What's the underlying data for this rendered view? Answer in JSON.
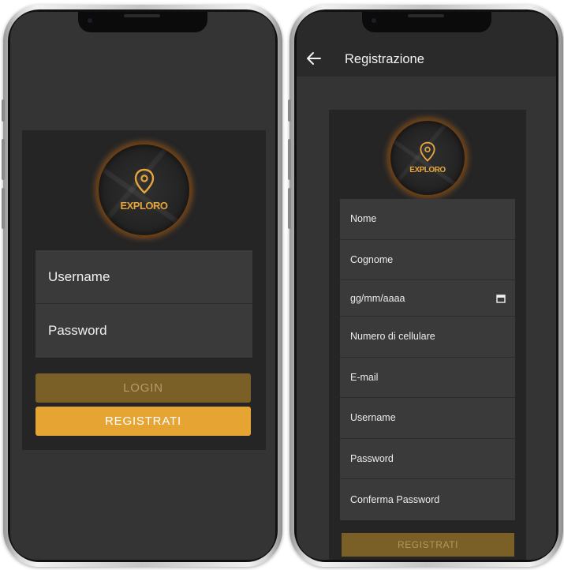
{
  "login_screen": {
    "logo_text": "EXPLORO",
    "username_placeholder": "Username",
    "password_placeholder": "Password",
    "login_label": "LOGIN",
    "register_label": "REGISTRATI"
  },
  "register_screen": {
    "title": "Registrazione",
    "logo_text": "EXPLORO",
    "fields": [
      {
        "label": "Nome"
      },
      {
        "label": "Cognome"
      },
      {
        "label": "gg/mm/aaaa"
      },
      {
        "label": "Numero di cellulare"
      },
      {
        "label": "E-mail"
      },
      {
        "label": "Username"
      },
      {
        "label": "Password"
      },
      {
        "label": "Conferma Password"
      }
    ],
    "register_label": "REGISTRATI"
  },
  "icons": {
    "logo": "location-pin-icon",
    "back": "arrow-back-icon",
    "calendar": "calendar-icon"
  },
  "colors": {
    "accent": "#e6a532",
    "accent_disabled": "#7a5f27",
    "background": "#343434",
    "card": "#252525",
    "field": "#3a3a3a"
  }
}
